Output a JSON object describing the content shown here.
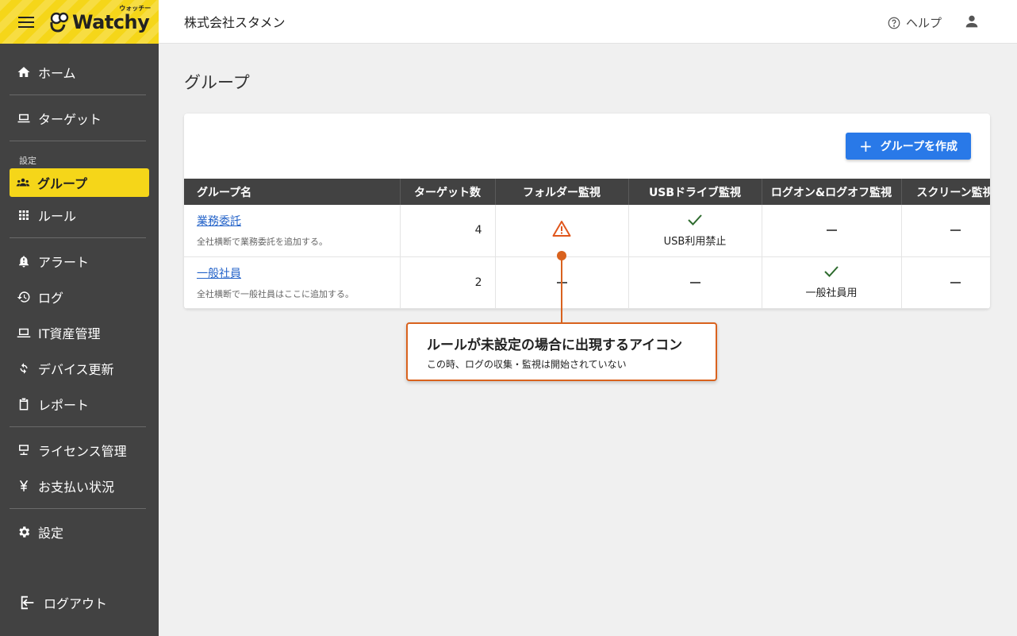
{
  "brand": {
    "name": "Watchy",
    "kana": "ウォッチー"
  },
  "header": {
    "company": "株式会社スタメン",
    "help_label": "ヘルプ"
  },
  "sidebar": {
    "items": [
      {
        "label": "ホーム",
        "icon": "home-icon"
      },
      {
        "label": "ターゲット",
        "icon": "target-monitor-icon"
      },
      {
        "section": "設定"
      },
      {
        "label": "グループ",
        "icon": "group-icon",
        "active": true
      },
      {
        "label": "ルール",
        "icon": "grid-icon"
      },
      {
        "label": "アラート",
        "icon": "bell-alert-icon"
      },
      {
        "label": "ログ",
        "icon": "history-icon"
      },
      {
        "label": "IT資産管理",
        "icon": "laptop-icon"
      },
      {
        "label": "デバイス更新",
        "icon": "sync-icon"
      },
      {
        "label": "レポート",
        "icon": "clipboard-icon"
      },
      {
        "label": "ライセンス管理",
        "icon": "license-icon"
      },
      {
        "label": "お支払い状況",
        "icon": "yen-icon"
      },
      {
        "label": "設定",
        "icon": "gear-icon"
      }
    ],
    "logout_label": "ログアウト"
  },
  "main": {
    "title": "グループ",
    "create_button": "グループを作成",
    "table": {
      "headers": [
        "グループ名",
        "ターゲット数",
        "フォルダー監視",
        "USBドライブ監視",
        "ログオン&ログオフ監視",
        "スクリーン監視"
      ],
      "rows": [
        {
          "name": "業務委託",
          "desc": "全社横断で業務委託を追加する。",
          "count": "4",
          "folder": "warning",
          "usb": {
            "state": "check",
            "label": "USB利用禁止"
          },
          "logon": "dash",
          "screen": "dash"
        },
        {
          "name": "一般社員",
          "desc": "全社横断で一般社員はここに追加する。",
          "count": "2",
          "folder": "dash",
          "usb": "dash",
          "logon": {
            "state": "check",
            "label": "一般社員用"
          },
          "screen": "dash"
        }
      ]
    }
  },
  "callout": {
    "title": "ルールが未設定の場合に出現するアイコン",
    "subtitle": "この時、ログの収集・監視は開始されていない"
  },
  "colors": {
    "brand_yellow": "#f5d619",
    "sidebar": "#424242",
    "primary": "#2979e8",
    "callout": "#d9621e",
    "warning": "#e0561c"
  }
}
